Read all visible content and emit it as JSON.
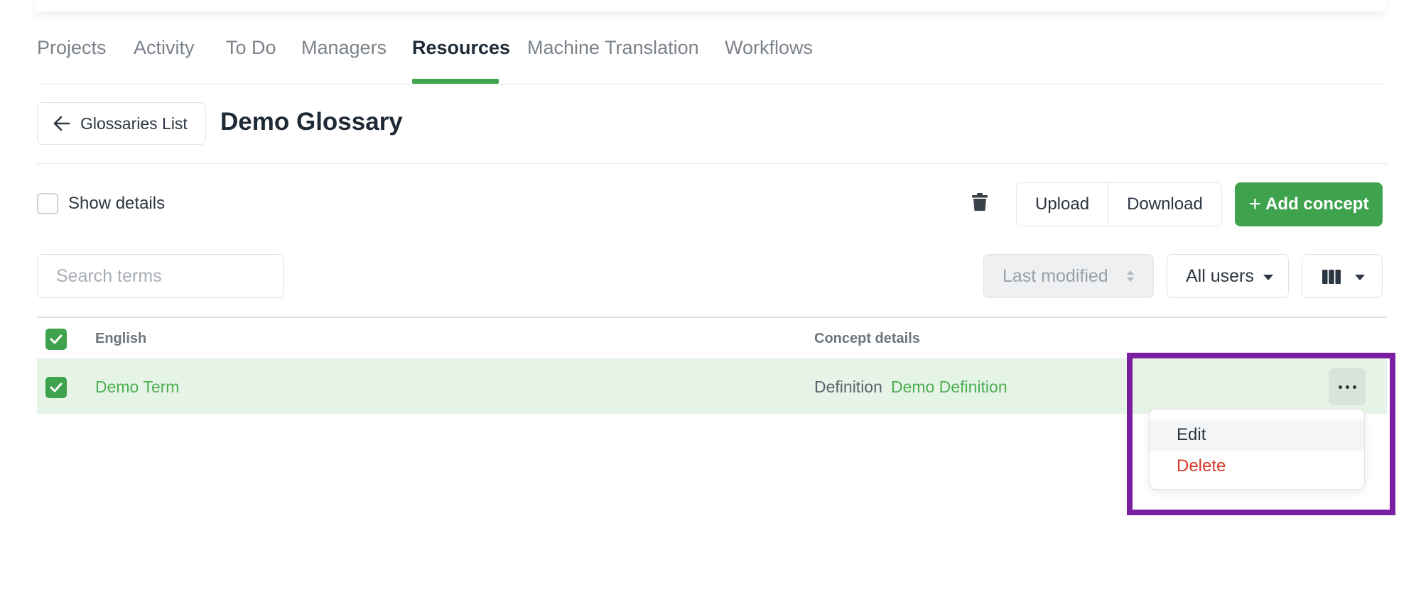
{
  "nav": {
    "tabs": [
      {
        "label": "Projects"
      },
      {
        "label": "Activity"
      },
      {
        "label": "To Do"
      },
      {
        "label": "Managers"
      },
      {
        "label": "Resources"
      },
      {
        "label": "Machine Translation"
      },
      {
        "label": "Workflows"
      }
    ],
    "active_tab": "Resources",
    "accent_color": "#3fa34d"
  },
  "header": {
    "back_label": "Glossaries List",
    "title": "Demo Glossary"
  },
  "toolbar": {
    "show_details_label": "Show details",
    "show_details_checked": false,
    "upload_label": "Upload",
    "download_label": "Download",
    "add_concept_label": "Add concept"
  },
  "filters": {
    "search_placeholder": "Search terms",
    "sort_label": "Last modified",
    "users_label": "All users"
  },
  "table": {
    "headers": {
      "term": "English",
      "details": "Concept details"
    },
    "rows": [
      {
        "term": "Demo Term",
        "definition_label": "Definition",
        "definition_value": "Demo Definition",
        "selected": true
      }
    ]
  },
  "context_menu": {
    "edit_label": "Edit",
    "delete_label": "Delete",
    "delete_color": "#d9372b"
  }
}
